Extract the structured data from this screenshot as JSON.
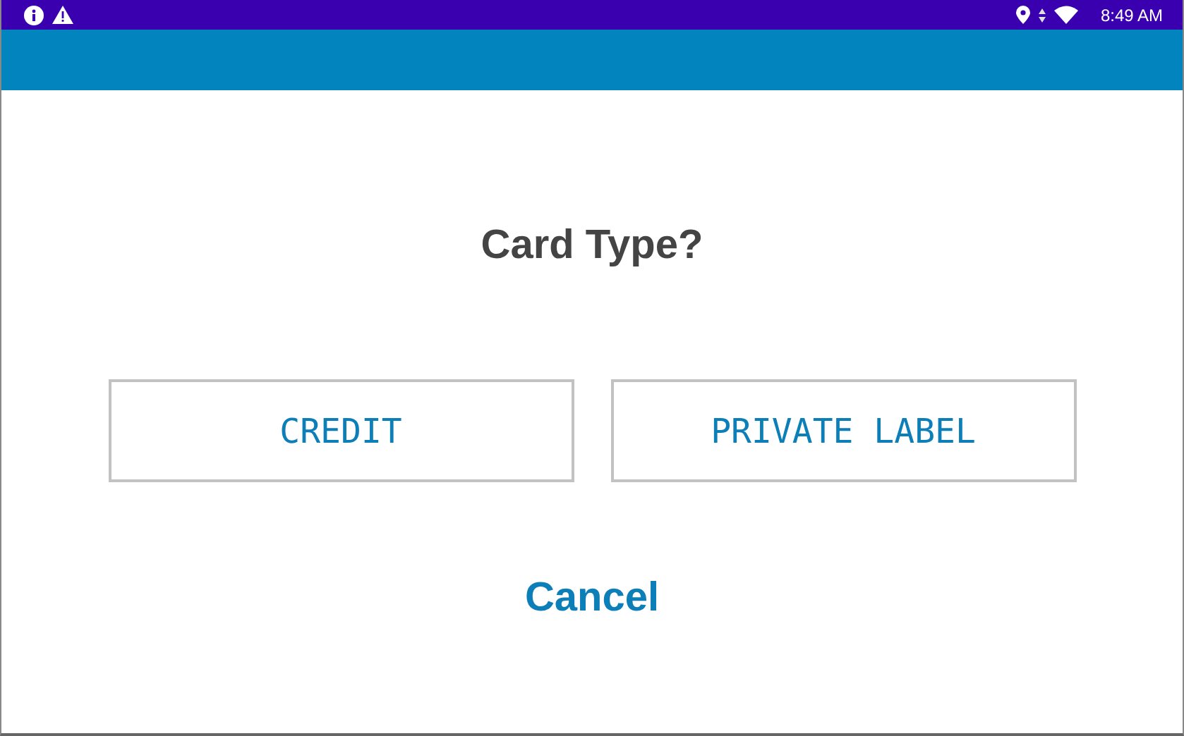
{
  "status_bar": {
    "time": "8:49 AM"
  },
  "title": "Card Type?",
  "options": [
    {
      "label": "CREDIT"
    },
    {
      "label": "PRIVATE LABEL"
    }
  ],
  "cancel": "Cancel"
}
